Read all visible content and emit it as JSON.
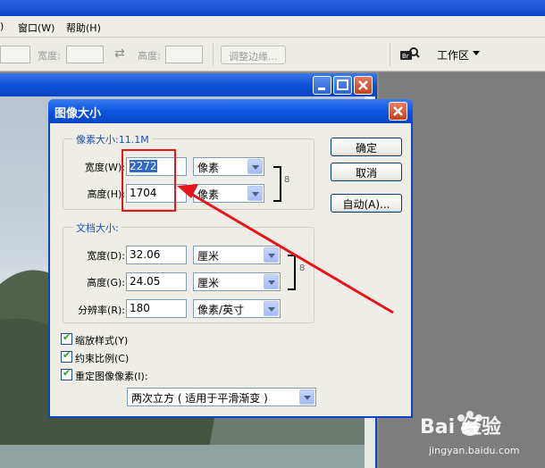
{
  "menu": {
    "partial_item": ")",
    "window": "窗口(W)",
    "help": "帮助(H)"
  },
  "options_bar": {
    "width_label": "宽度:",
    "height_label": "高度:",
    "refine_edge": "调整边缘...",
    "workspace": "工作区"
  },
  "dialog": {
    "title": "图像大小",
    "pixel_dimensions": {
      "legend": "像素大小:11.1M",
      "width_label": "宽度(W):",
      "width_value": "2272",
      "width_unit": "像素",
      "height_label": "高度(H):",
      "height_value": "1704",
      "height_unit": "像素"
    },
    "document_size": {
      "legend": "文档大小:",
      "width_label": "宽度(D):",
      "width_value": "32.06",
      "width_unit": "厘米",
      "height_label": "高度(G):",
      "height_value": "24.05",
      "height_unit": "厘米",
      "resolution_label": "分辨率(R):",
      "resolution_value": "180",
      "resolution_unit": "像素/英寸"
    },
    "buttons": {
      "ok": "确定",
      "cancel": "取消",
      "auto": "自动(A)..."
    },
    "checkboxes": {
      "scale_styles": "缩放样式(Y)",
      "constrain_proportions": "约束比例(C)",
      "resample": "重定图像像素(I):"
    },
    "resample_method": "两次立方 ( 适用于平滑渐变 )"
  },
  "watermark": {
    "brand": "Bai 经验",
    "url": "jingyan.baidu.com"
  },
  "colors": {
    "title_blue": "#0a45c8",
    "annotation_red": "#e8141c",
    "legend_blue": "#1b4fb8"
  }
}
